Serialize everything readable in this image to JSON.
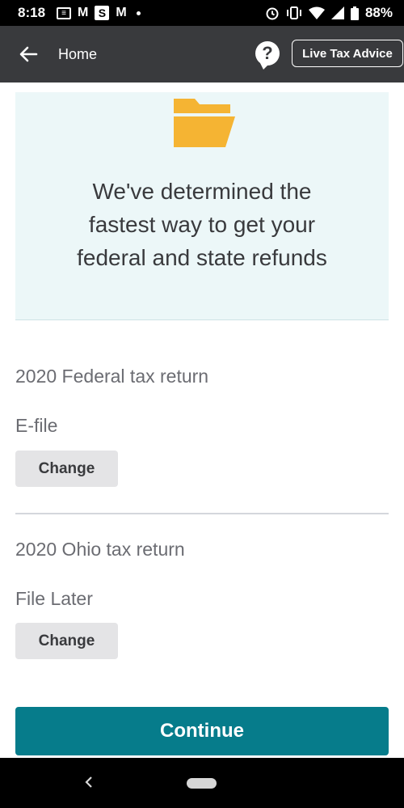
{
  "status_bar": {
    "time": "8:18",
    "battery": "88%",
    "notifications": [
      "message-icon",
      "gmail-icon",
      "s-icon",
      "gmail-icon"
    ]
  },
  "app_bar": {
    "title": "Home",
    "help_label": "?",
    "live_button": "Live Tax Advice"
  },
  "hero": {
    "line1": "We've determined the",
    "line2": "fastest way to get your",
    "line3": "federal and state refunds",
    "folder_color": "#f5b433"
  },
  "federal": {
    "title": "2020 Federal tax return",
    "method": "E-file",
    "change_label": "Change"
  },
  "state": {
    "title": "2020 Ohio tax return",
    "method": "File Later",
    "change_label": "Change"
  },
  "continue_label": "Continue",
  "colors": {
    "accent": "#067c8b",
    "app_bar": "#393a3d",
    "hero_bg": "#ecf7f8"
  }
}
